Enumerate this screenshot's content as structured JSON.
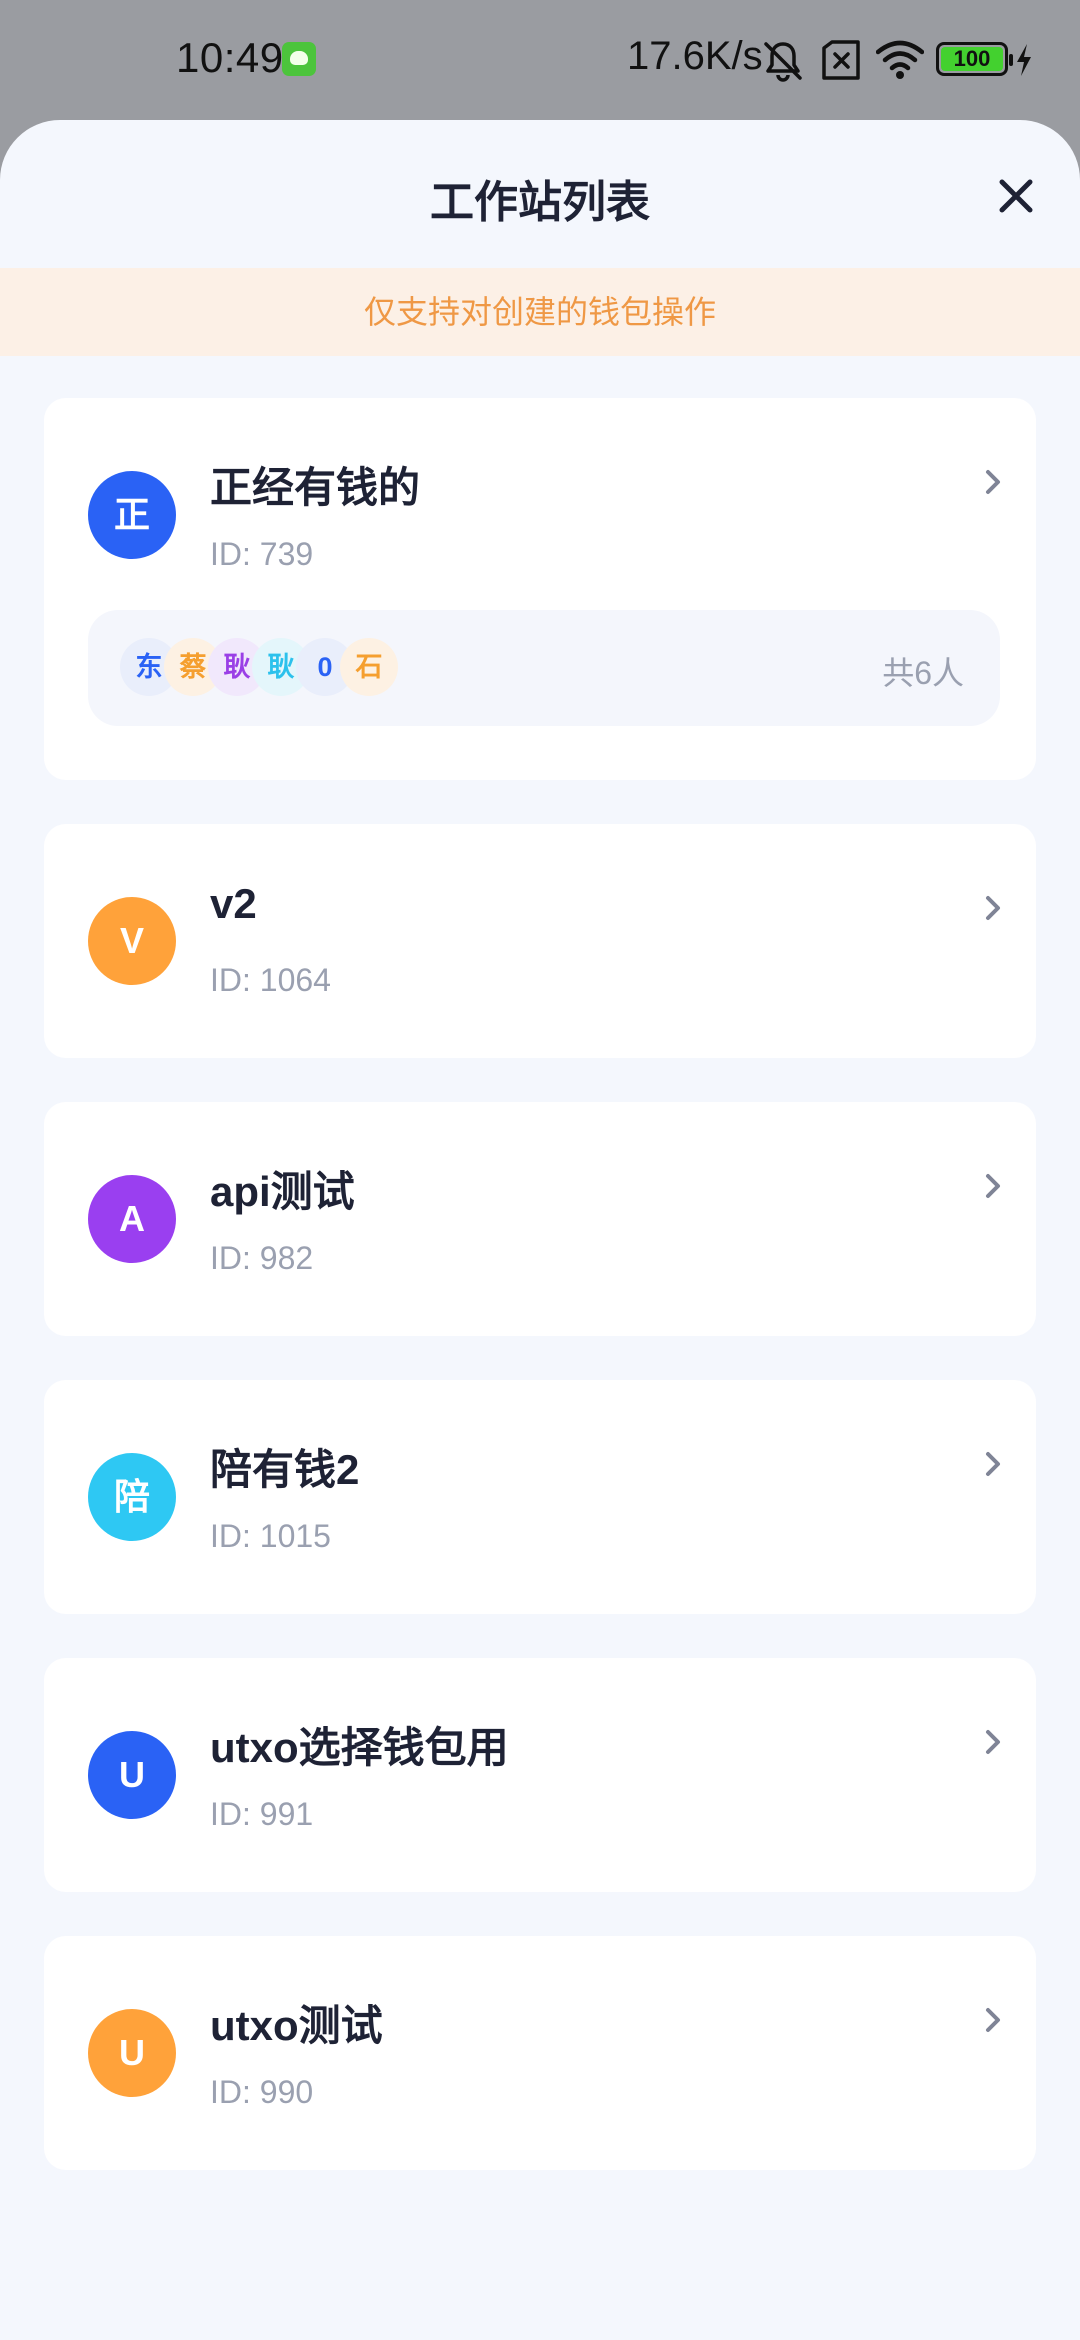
{
  "status_bar": {
    "time": "10:49",
    "net_speed": "17.6K/s",
    "battery": "100",
    "icons": [
      "app-notification-icon",
      "bell-muted-icon",
      "sim-x-icon",
      "wifi-icon",
      "battery-icon",
      "charging-icon"
    ]
  },
  "sheet": {
    "title": "工作站列表",
    "notice": "仅支持对创建的钱包操作"
  },
  "workstations": [
    {
      "avatar": "正",
      "color": "#2a62f5",
      "name": "正经有钱的",
      "id": "ID: 739",
      "members": [
        {
          "char": "东",
          "bg": "#e9eefb",
          "fg": "#2a62f5"
        },
        {
          "char": "蔡",
          "bg": "#fdf1e3",
          "fg": "#f59f2f"
        },
        {
          "char": "耿",
          "bg": "#f1e8fc",
          "fg": "#9a3fe6"
        },
        {
          "char": "耿",
          "bg": "#e4f6fb",
          "fg": "#2cc1ec"
        },
        {
          "char": "0",
          "bg": "#e9eefb",
          "fg": "#2a62f5"
        },
        {
          "char": "石",
          "bg": "#fdf1e3",
          "fg": "#f59f2f"
        }
      ],
      "member_count": "共6人"
    },
    {
      "avatar": "V",
      "color": "#ffa23a",
      "name": "v2",
      "id": "ID: 1064"
    },
    {
      "avatar": "A",
      "color": "#9a3ff0",
      "name": "api测试",
      "id": "ID: 982"
    },
    {
      "avatar": "陪",
      "color": "#2ec8f3",
      "name": "陪有钱2",
      "id": "ID: 1015"
    },
    {
      "avatar": "U",
      "color": "#2a62f5",
      "name": "utxo选择钱包用",
      "id": "ID: 991"
    },
    {
      "avatar": "U",
      "color": "#ffa23a",
      "name": "utxo测试",
      "id": "ID: 990"
    }
  ]
}
